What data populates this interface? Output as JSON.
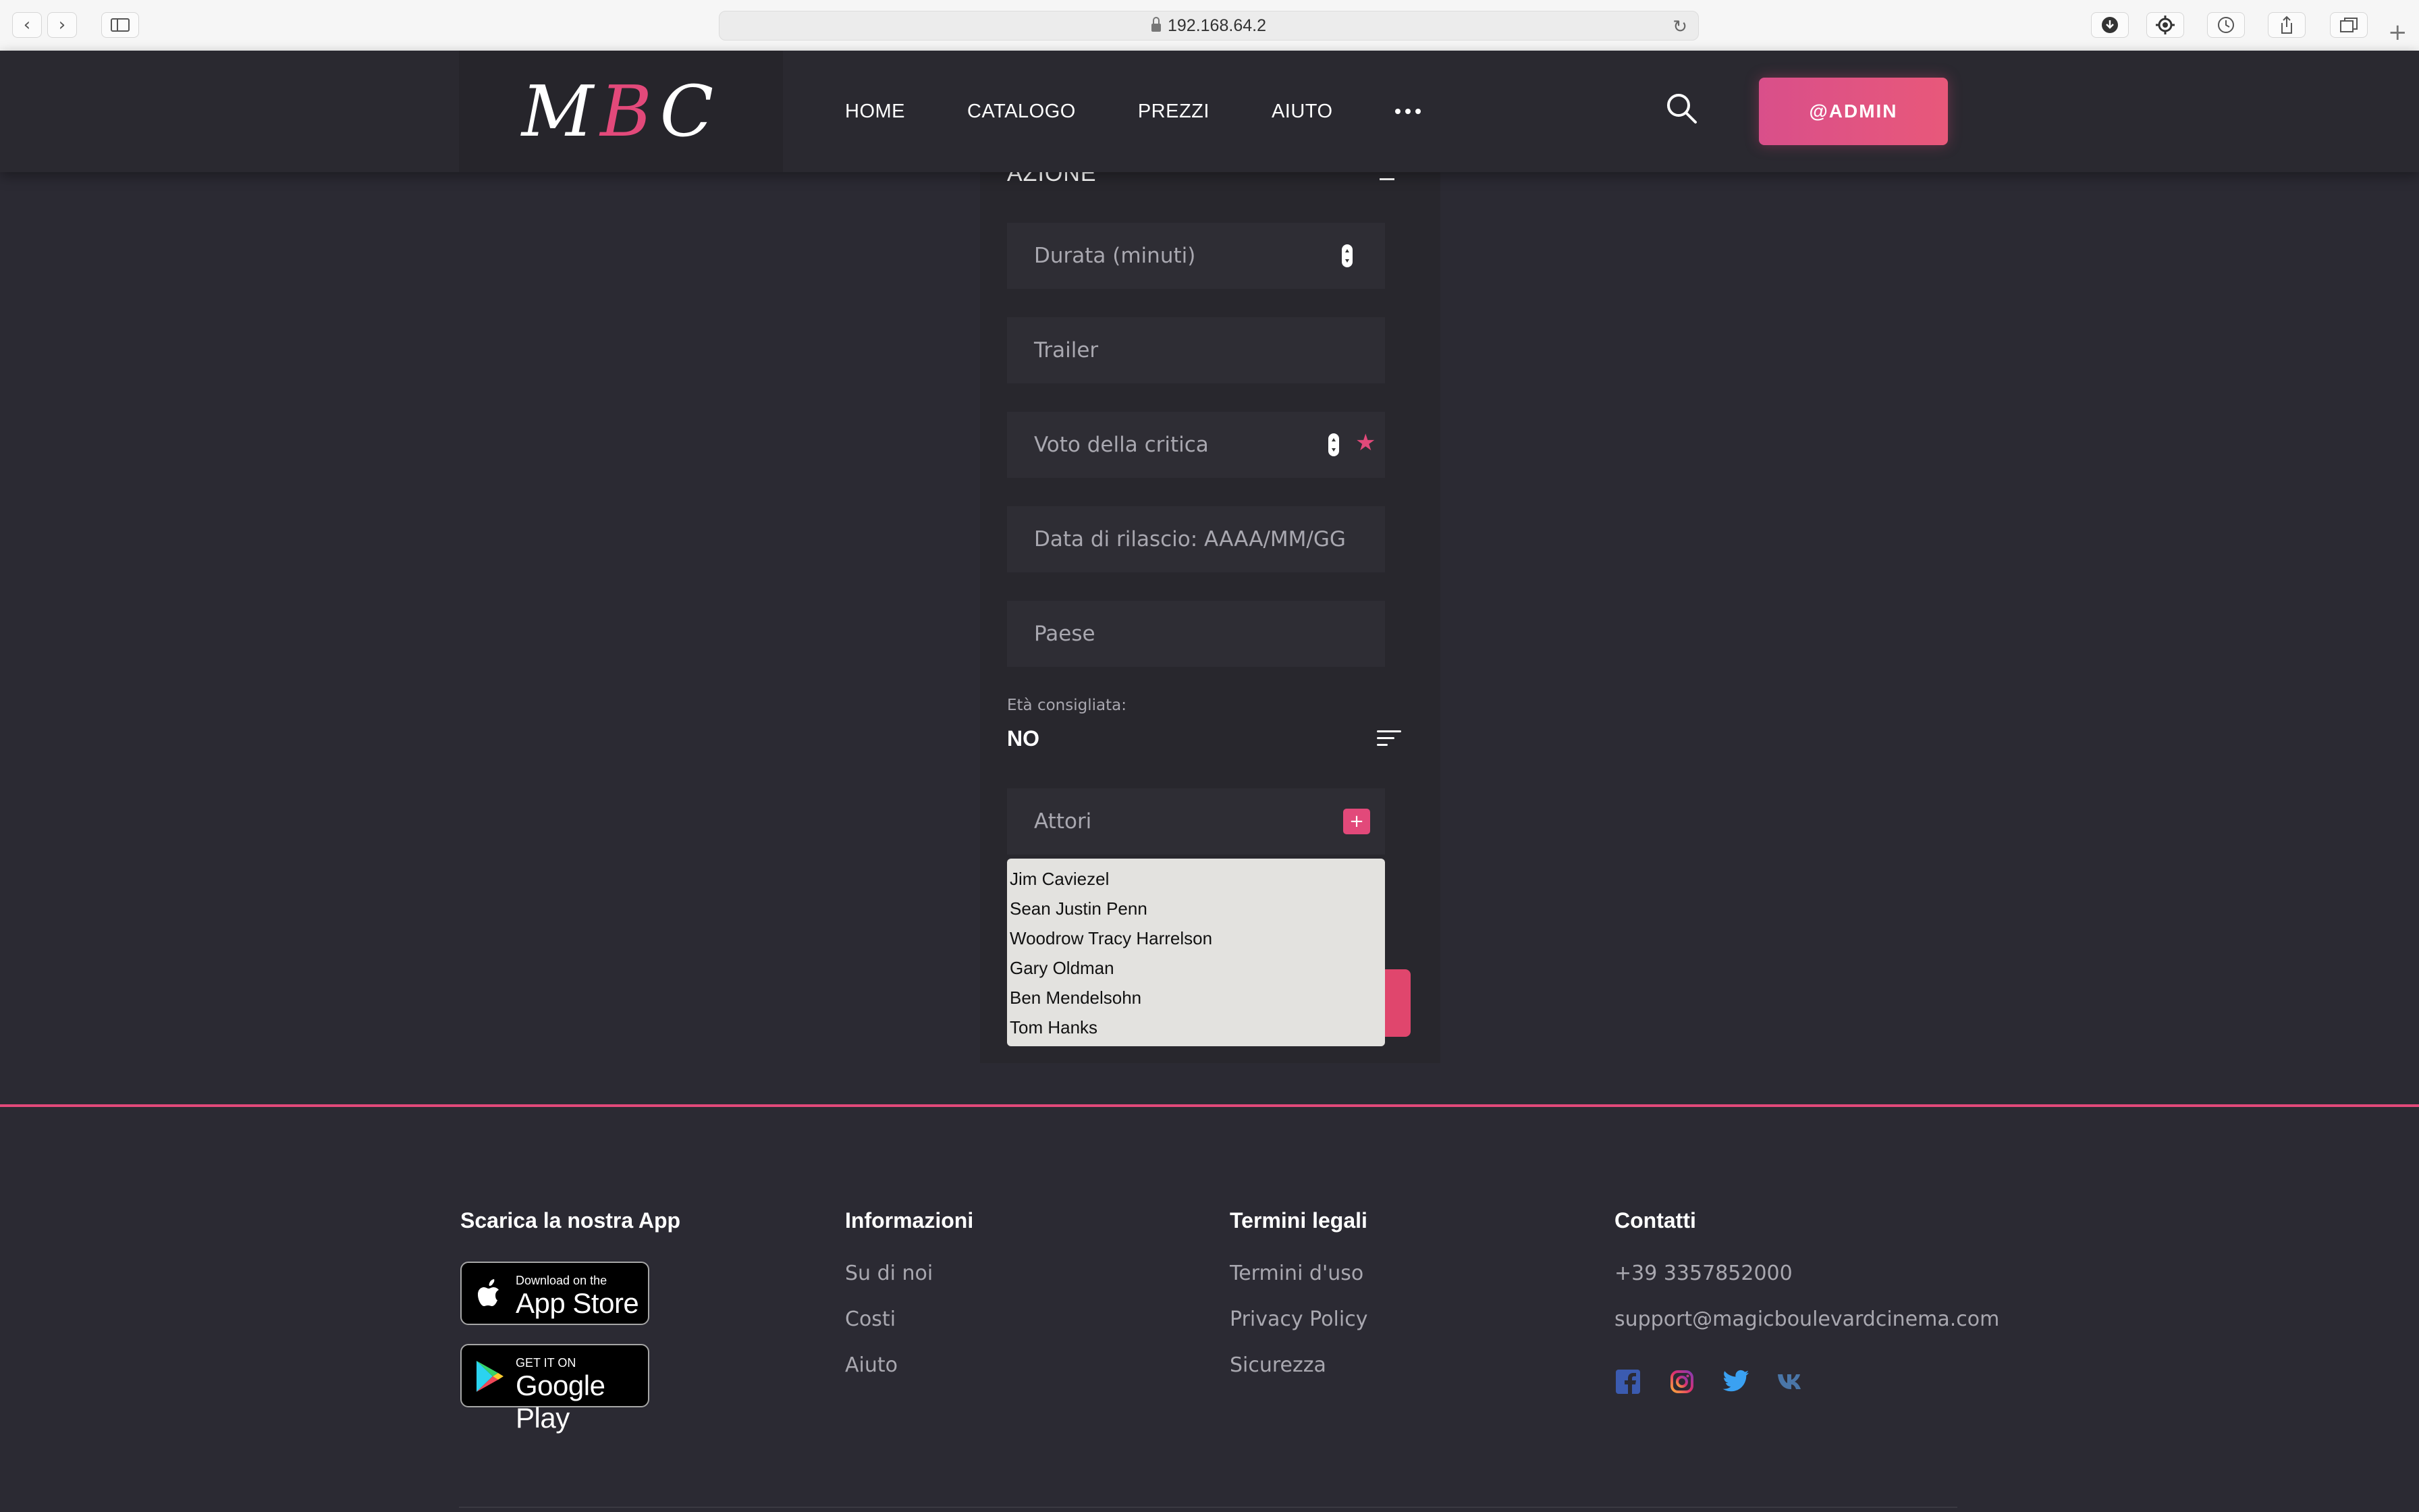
{
  "browser": {
    "url": "192.168.64.2"
  },
  "header": {
    "logo_text": "MBC",
    "nav": [
      "HOME",
      "CATALOGO",
      "PREZZI",
      "AIUTO"
    ],
    "account_label": "@ADMIN"
  },
  "form": {
    "genre_label": "AZIONE",
    "fields": {
      "duration_placeholder": "Durata (minuti)",
      "trailer_placeholder": "Trailer",
      "critic_rating_placeholder": "Voto della critica",
      "release_date_placeholder": "Data di rilascio: AAAA/MM/GG",
      "country_placeholder": "Paese",
      "actors_placeholder": "Attori"
    },
    "age_label": "Età consigliata:",
    "age_value": "NO",
    "add_actor_symbol": "+",
    "actor_options": [
      "Jim Caviezel",
      "Sean Justin Penn",
      "Woodrow Tracy Harrelson",
      "Gary Oldman",
      "Ben Mendelsohn",
      "Tom Hanks"
    ]
  },
  "footer": {
    "app_title": "Scarica la nostra App",
    "app_store": {
      "small": "Download on the",
      "big": "App Store"
    },
    "google_play": {
      "small": "GET IT ON",
      "big": "Google Play"
    },
    "info_title": "Informazioni",
    "info_links": [
      "Su di noi",
      "Costi",
      "Aiuto"
    ],
    "legal_title": "Termini legali",
    "legal_links": [
      "Termini d'uso",
      "Privacy Policy",
      "Sicurezza"
    ],
    "contacts_title": "Contatti",
    "phone": "+39 3357852000",
    "email": "support@magicboulevardcinema.com",
    "socials": [
      "facebook-icon",
      "instagram-icon",
      "twitter-icon",
      "vk-icon"
    ]
  },
  "colors": {
    "accent": "#e2497a",
    "background": "#2b2a33",
    "field": "#2e2d34"
  }
}
